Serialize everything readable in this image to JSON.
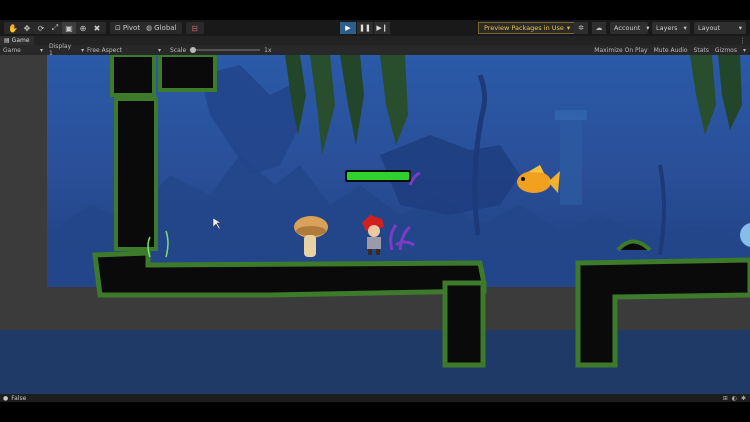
{
  "toolbar": {
    "pivot_label": "Pivot",
    "global_label": "Global",
    "preview_packages_label": "Preview Packages in Use",
    "account_label": "Account",
    "layers_label": "Layers",
    "layout_label": "Layout"
  },
  "tab": {
    "game_label": "Game"
  },
  "gamebar": {
    "view_select": "Game",
    "display_select": "Display 1",
    "aspect_select": "Free Aspect",
    "scale_label": "Scale",
    "scale_value": "1x",
    "scale_fraction": 0.0,
    "maximize_label": "Maximize On Play",
    "mute_label": "Mute Audio",
    "stats_label": "Stats",
    "gizmos_label": "Gizmos"
  },
  "status": {
    "message": "False"
  },
  "colors": {
    "editor_bg": "#191919",
    "accent_play": "#2d5f8a",
    "preview_text": "#f0c040",
    "health_bar": "#2fd12f",
    "water": "#1f3a66"
  },
  "icons": {
    "hand": "hand-icon",
    "move": "move-icon",
    "rotate": "rotate-icon",
    "scale": "scale-icon",
    "rect": "rect-tool-icon",
    "transform": "transform-icon",
    "custom": "custom-tool-icon"
  }
}
